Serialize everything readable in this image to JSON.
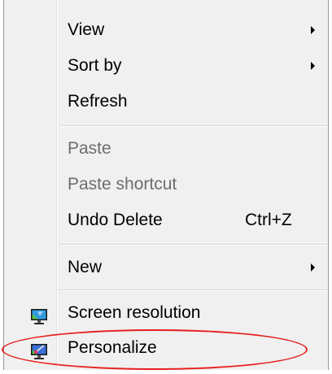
{
  "context_menu": {
    "items": [
      {
        "label": "View",
        "has_submenu": true,
        "enabled": true
      },
      {
        "label": "Sort by",
        "has_submenu": true,
        "enabled": true
      },
      {
        "label": "Refresh",
        "has_submenu": false,
        "enabled": true
      },
      {
        "label": "Paste",
        "has_submenu": false,
        "enabled": false
      },
      {
        "label": "Paste shortcut",
        "has_submenu": false,
        "enabled": false
      },
      {
        "label": "Undo Delete",
        "shortcut": "Ctrl+Z",
        "has_submenu": false,
        "enabled": true
      },
      {
        "label": "New",
        "has_submenu": true,
        "enabled": true
      },
      {
        "label": "Screen resolution",
        "icon": "monitor-icon",
        "has_submenu": false,
        "enabled": true
      },
      {
        "label": "Personalize",
        "icon": "personalize-icon",
        "has_submenu": false,
        "enabled": true
      }
    ]
  },
  "annotation": {
    "target": "Personalize",
    "color": "#e8201f"
  },
  "colors": {
    "menu_bg": "#f0f0f0",
    "disabled_text": "#6d6d6d",
    "highlight": "#e8201f"
  }
}
